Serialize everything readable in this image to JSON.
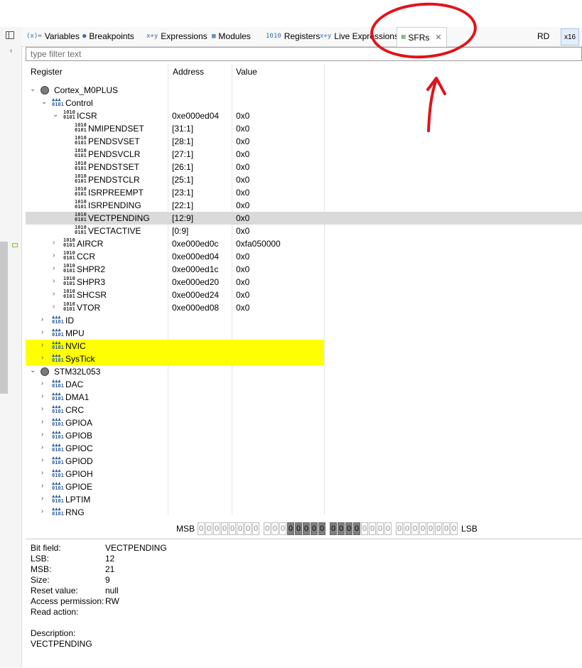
{
  "tabs": [
    {
      "label": "Variables",
      "icon": "variables-icon",
      "glyph": "(x)="
    },
    {
      "label": "Breakpoints",
      "icon": "breakpoints-icon",
      "glyph": "●"
    },
    {
      "label": "Expressions",
      "icon": "expressions-icon",
      "glyph": "x+y"
    },
    {
      "label": "Modules",
      "icon": "modules-icon",
      "glyph": "▦"
    },
    {
      "label": "Registers",
      "icon": "registers-icon",
      "glyph": "1010"
    },
    {
      "label": "Live Expressions",
      "icon": "live-expressions-icon",
      "glyph": "x+y"
    },
    {
      "label": "SFRs",
      "icon": "sfrs-icon",
      "glyph": "▤",
      "active": true
    }
  ],
  "toolbar": {
    "rd_label": "RD",
    "x16_label": "x16"
  },
  "filter": {
    "placeholder": "type filter text"
  },
  "columns": {
    "register": "Register",
    "address": "Address",
    "value": "Value"
  },
  "rows": [
    {
      "name": "Cortex_M0PLUS",
      "level": 0,
      "expand": "open",
      "icon": "group",
      "address": "",
      "value": ""
    },
    {
      "name": "Control",
      "level": 1,
      "expand": "open",
      "icon": "folder",
      "address": "",
      "value": ""
    },
    {
      "name": "ICSR",
      "level": 2,
      "expand": "open",
      "icon": "register",
      "address": "0xe000ed04",
      "value": "0x0"
    },
    {
      "name": "NMIPENDSET",
      "level": 3,
      "expand": "",
      "icon": "field",
      "address": "[31:1]",
      "value": "0x0"
    },
    {
      "name": "PENDSVSET",
      "level": 3,
      "expand": "",
      "icon": "field",
      "address": "[28:1]",
      "value": "0x0"
    },
    {
      "name": "PENDSVCLR",
      "level": 3,
      "expand": "",
      "icon": "field",
      "address": "[27:1]",
      "value": "0x0"
    },
    {
      "name": "PENDSTSET",
      "level": 3,
      "expand": "",
      "icon": "field",
      "address": "[26:1]",
      "value": "0x0"
    },
    {
      "name": "PENDSTCLR",
      "level": 3,
      "expand": "",
      "icon": "field",
      "address": "[25:1]",
      "value": "0x0"
    },
    {
      "name": "ISRPREEMPT",
      "level": 3,
      "expand": "",
      "icon": "field",
      "address": "[23:1]",
      "value": "0x0"
    },
    {
      "name": "ISRPENDING",
      "level": 3,
      "expand": "",
      "icon": "field",
      "address": "[22:1]",
      "value": "0x0"
    },
    {
      "name": "VECTPENDING",
      "level": 3,
      "expand": "",
      "icon": "field",
      "address": "[12:9]",
      "value": "0x0",
      "selected": true
    },
    {
      "name": "VECTACTIVE",
      "level": 3,
      "expand": "",
      "icon": "field",
      "address": "[0:9]",
      "value": "0x0"
    },
    {
      "name": "AIRCR",
      "level": 2,
      "expand": "closed",
      "icon": "register",
      "address": "0xe000ed0c",
      "value": "0xfa050000"
    },
    {
      "name": "CCR",
      "level": 2,
      "expand": "closed",
      "icon": "register",
      "address": "0xe000ed04",
      "value": "0x0"
    },
    {
      "name": "SHPR2",
      "level": 2,
      "expand": "closed",
      "icon": "register",
      "address": "0xe000ed1c",
      "value": "0x0"
    },
    {
      "name": "SHPR3",
      "level": 2,
      "expand": "closed",
      "icon": "register",
      "address": "0xe000ed20",
      "value": "0x0"
    },
    {
      "name": "SHCSR",
      "level": 2,
      "expand": "closed",
      "icon": "register",
      "address": "0xe000ed24",
      "value": "0x0"
    },
    {
      "name": "VTOR",
      "level": 2,
      "expand": "closed",
      "icon": "register",
      "address": "0xe000ed08",
      "value": "0x0"
    },
    {
      "name": "ID",
      "level": 1,
      "expand": "closed",
      "icon": "folder",
      "address": "",
      "value": ""
    },
    {
      "name": "MPU",
      "level": 1,
      "expand": "closed",
      "icon": "folder",
      "address": "",
      "value": ""
    },
    {
      "name": "NVIC",
      "level": 1,
      "expand": "closed",
      "icon": "folder",
      "address": "",
      "value": "",
      "highlight": true
    },
    {
      "name": "SysTick",
      "level": 1,
      "expand": "closed",
      "icon": "folder",
      "address": "",
      "value": "",
      "highlight": true
    },
    {
      "name": "STM32L053",
      "level": 0,
      "expand": "open",
      "icon": "group",
      "address": "",
      "value": ""
    },
    {
      "name": "DAC",
      "level": 1,
      "expand": "closed",
      "icon": "folder",
      "address": "",
      "value": ""
    },
    {
      "name": "DMA1",
      "level": 1,
      "expand": "closed",
      "icon": "folder",
      "address": "",
      "value": ""
    },
    {
      "name": "CRC",
      "level": 1,
      "expand": "closed",
      "icon": "folder",
      "address": "",
      "value": ""
    },
    {
      "name": "GPIOA",
      "level": 1,
      "expand": "closed",
      "icon": "folder",
      "address": "",
      "value": ""
    },
    {
      "name": "GPIOB",
      "level": 1,
      "expand": "closed",
      "icon": "folder",
      "address": "",
      "value": ""
    },
    {
      "name": "GPIOC",
      "level": 1,
      "expand": "closed",
      "icon": "folder",
      "address": "",
      "value": ""
    },
    {
      "name": "GPIOD",
      "level": 1,
      "expand": "closed",
      "icon": "folder",
      "address": "",
      "value": ""
    },
    {
      "name": "GPIOH",
      "level": 1,
      "expand": "closed",
      "icon": "folder",
      "address": "",
      "value": ""
    },
    {
      "name": "GPIOE",
      "level": 1,
      "expand": "closed",
      "icon": "folder",
      "address": "",
      "value": ""
    },
    {
      "name": "LPTIM",
      "level": 1,
      "expand": "closed",
      "icon": "folder",
      "address": "",
      "value": ""
    },
    {
      "name": "RNG",
      "level": 1,
      "expand": "closed",
      "icon": "folder",
      "address": "",
      "value": ""
    }
  ],
  "bitbar": {
    "msb_label": "MSB",
    "lsb_label": "LSB",
    "bits": [
      "0",
      "0",
      "0",
      "0",
      "0",
      "0",
      "0",
      "0",
      "0",
      "0",
      "0",
      "0",
      "0",
      "0",
      "0",
      "0",
      "0",
      "0",
      "0",
      "0",
      "0",
      "0",
      "0",
      "0",
      "0",
      "0",
      "0",
      "0",
      "0",
      "0",
      "0",
      "0"
    ],
    "highlighted_bits": [
      12,
      13,
      14,
      15,
      16,
      17,
      18,
      19,
      20
    ]
  },
  "details": [
    {
      "label": "Bit field:",
      "value": "VECTPENDING"
    },
    {
      "label": "LSB:",
      "value": "12"
    },
    {
      "label": "MSB:",
      "value": "21"
    },
    {
      "label": "Size:",
      "value": "9"
    },
    {
      "label": "Reset value:",
      "value": "null"
    },
    {
      "label": "Access permission:",
      "value": "RW"
    },
    {
      "label": "Read action:",
      "value": ""
    },
    {
      "label": "",
      "value": ""
    },
    {
      "label": "Description:",
      "value": ""
    },
    {
      "label": "VECTPENDING",
      "value": ""
    }
  ],
  "colors": {
    "highlight": "#ffff00",
    "selected": "#dadada",
    "annotation": "#e0141b"
  }
}
